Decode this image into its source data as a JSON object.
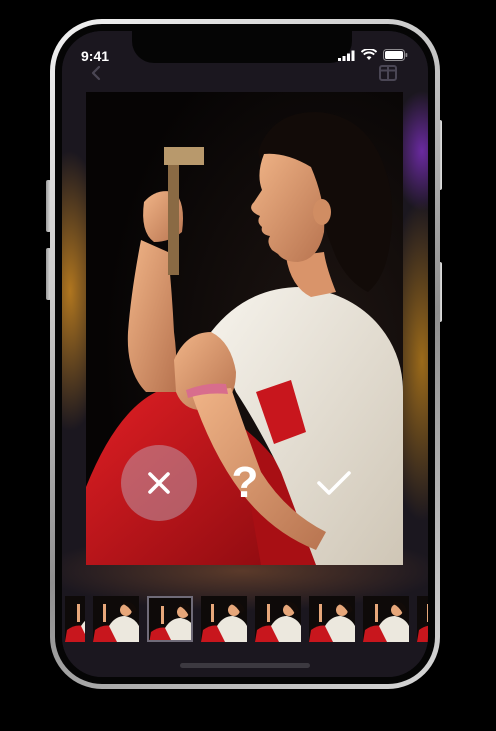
{
  "status_bar": {
    "time": "9:41"
  },
  "toolbar": {
    "back_icon": "chevron-left-icon",
    "compare_icon": "compare-icon",
    "rotate_icon": "rotate-icon"
  },
  "photo": {
    "subject": "woman-in-white-tshirt-holding-wooden-block"
  },
  "actions": {
    "reject_icon": "close-icon",
    "unsure_label": "?",
    "accept_icon": "check-icon"
  },
  "thumbnails": {
    "count": 8,
    "selected_index": 2
  },
  "colors": {
    "accent_red": "#c8161d",
    "shirt": "#ece8de",
    "skin": "#e7a77a",
    "button_bg": "#bcb4c3"
  }
}
